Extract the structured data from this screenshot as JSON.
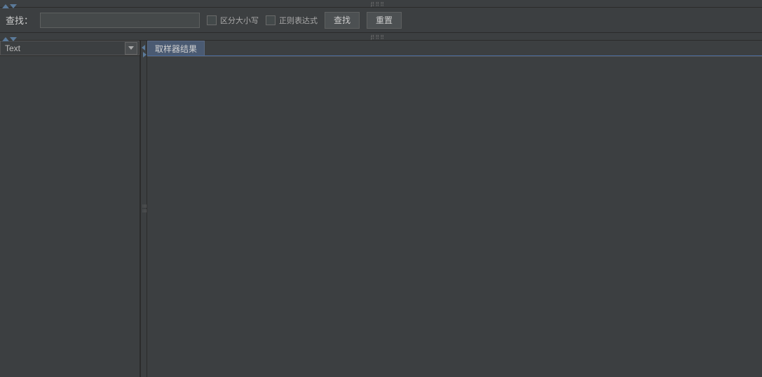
{
  "search": {
    "label": "查找：",
    "value": "",
    "case_sensitive_label": "区分大小写",
    "regex_label": "正则表达式",
    "search_button": "查找",
    "reset_button": "重置"
  },
  "left_panel": {
    "dropdown_value": "Text"
  },
  "right_panel": {
    "tab_label": "取样器结果"
  }
}
